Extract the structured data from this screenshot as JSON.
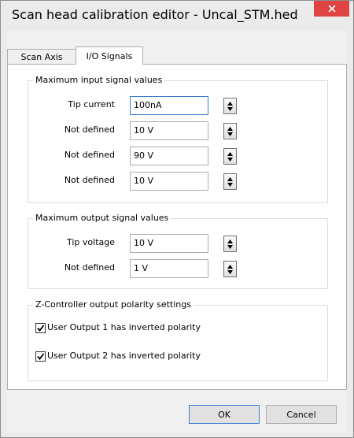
{
  "window": {
    "title": "Scan head calibration editor - Uncal_STM.hed"
  },
  "tabs": [
    {
      "label": "Scan Axis"
    },
    {
      "label": "I/O Signals"
    }
  ],
  "input_group": {
    "legend": "Maximum input signal values",
    "rows": [
      {
        "label": "Tip current",
        "value": "100nA"
      },
      {
        "label": "Not defined",
        "value": "10 V"
      },
      {
        "label": "Not defined",
        "value": "90 V"
      },
      {
        "label": "Not defined",
        "value": "10 V"
      }
    ]
  },
  "output_group": {
    "legend": "Maximum output signal values",
    "rows": [
      {
        "label": "Tip voltage",
        "value": "10 V"
      },
      {
        "label": "Not defined",
        "value": "1 V"
      }
    ]
  },
  "polarity_group": {
    "legend": "Z-Controller output polarity settings",
    "checks": [
      {
        "label": "User Output 1 has inverted polarity",
        "checked": true
      },
      {
        "label": "User Output 2 has inverted polarity",
        "checked": true
      }
    ]
  },
  "buttons": {
    "ok": "OK",
    "cancel": "Cancel"
  },
  "colors": {
    "close_button": "#e04343",
    "focus_border": "#3b7fd1"
  },
  "icons": {
    "close": "close-icon",
    "spin": "spin-arrows-icon",
    "check": "checkmark-icon"
  }
}
